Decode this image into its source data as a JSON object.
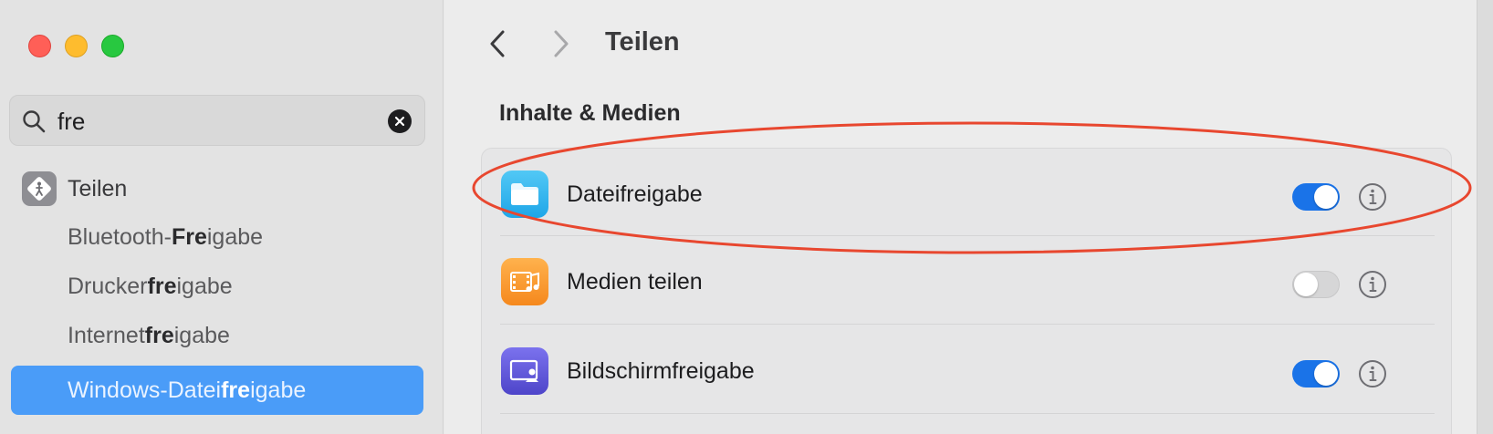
{
  "window": {
    "controls": [
      "close",
      "minimize",
      "zoom"
    ]
  },
  "sidebar": {
    "search": {
      "value": "fre",
      "placeholder": ""
    },
    "header": {
      "label": "Teilen",
      "icon": "share-person-icon"
    },
    "items": [
      {
        "pre": "Bluetooth-",
        "hl": "Fre",
        "post": "igabe",
        "selected": false
      },
      {
        "pre": "Drucker",
        "hl": "fre",
        "post": "igabe",
        "selected": false
      },
      {
        "pre": "Internet",
        "hl": "fre",
        "post": "igabe",
        "selected": false
      },
      {
        "pre": "Windows-Datei",
        "hl": "fre",
        "post": "igabe",
        "selected": true
      }
    ]
  },
  "main": {
    "title": "Teilen",
    "section_title": "Inhalte & Medien",
    "rows": [
      {
        "label": "Dateifreigabe",
        "icon": "folder-icon",
        "enabled": true
      },
      {
        "label": "Medien teilen",
        "icon": "media-icon",
        "enabled": false
      },
      {
        "label": "Bildschirmfreigabe",
        "icon": "screen-sharing-icon",
        "enabled": true
      }
    ]
  },
  "colors": {
    "accent": "#1a73e8",
    "selection": "#4a9cf8",
    "annotation": "#e8472f"
  }
}
